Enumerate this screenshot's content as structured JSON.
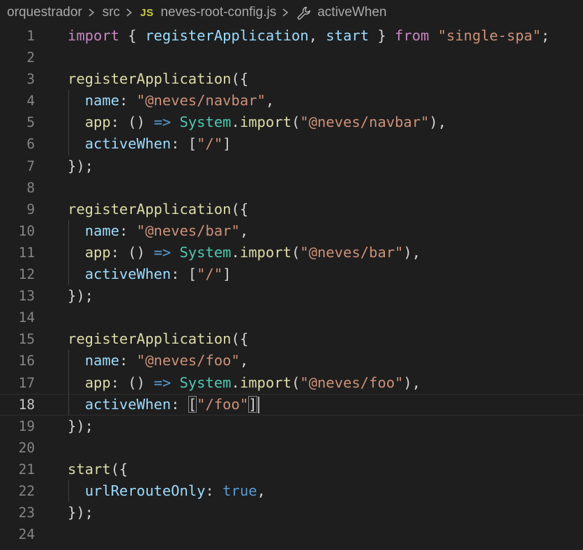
{
  "breadcrumb": {
    "folder": "orquestrador",
    "subfolder": "src",
    "file_badge": "JS",
    "file_name": "neves-root-config.js",
    "symbol": "activeWhen"
  },
  "colors": {
    "background": "#1e1e1e",
    "keyword": "#c586c0",
    "function": "#dcdcaa",
    "property": "#9cdcfe",
    "string": "#ce9178",
    "class": "#4ec9b0",
    "operator": "#569cd6",
    "line_number": "#858585",
    "js_badge": "#cbcb41"
  },
  "editor": {
    "current_line": 18,
    "lines": [
      {
        "n": "1",
        "tokens": [
          [
            "kw",
            "import"
          ],
          [
            "pn",
            " { "
          ],
          [
            "var",
            "registerApplication"
          ],
          [
            "pn",
            ", "
          ],
          [
            "var",
            "start"
          ],
          [
            "pn",
            " } "
          ],
          [
            "kw",
            "from"
          ],
          [
            "pn",
            " "
          ],
          [
            "str",
            "\"single-spa\""
          ],
          [
            "pn",
            ";"
          ]
        ]
      },
      {
        "n": "2",
        "tokens": []
      },
      {
        "n": "3",
        "tokens": [
          [
            "fn",
            "registerApplication"
          ],
          [
            "pn",
            "({"
          ]
        ]
      },
      {
        "n": "4",
        "tokens": [
          [
            "pn",
            "  "
          ],
          [
            "prop",
            "name"
          ],
          [
            "pn",
            ": "
          ],
          [
            "str",
            "\"@neves/navbar\""
          ],
          [
            "pn",
            ","
          ]
        ],
        "guide": true
      },
      {
        "n": "5",
        "tokens": [
          [
            "pn",
            "  "
          ],
          [
            "fn",
            "app"
          ],
          [
            "pn",
            ": () "
          ],
          [
            "op",
            "=>"
          ],
          [
            "pn",
            " "
          ],
          [
            "cls",
            "System"
          ],
          [
            "pn",
            "."
          ],
          [
            "fn",
            "import"
          ],
          [
            "pn",
            "("
          ],
          [
            "str",
            "\"@neves/navbar\""
          ],
          [
            "pn",
            "),"
          ]
        ],
        "guide": true
      },
      {
        "n": "6",
        "tokens": [
          [
            "pn",
            "  "
          ],
          [
            "prop",
            "activeWhen"
          ],
          [
            "pn",
            ": ["
          ],
          [
            "str",
            "\"/\""
          ],
          [
            "pn",
            "]"
          ]
        ],
        "guide": true
      },
      {
        "n": "7",
        "tokens": [
          [
            "pn",
            "});"
          ]
        ]
      },
      {
        "n": "8",
        "tokens": []
      },
      {
        "n": "9",
        "tokens": [
          [
            "fn",
            "registerApplication"
          ],
          [
            "pn",
            "({"
          ]
        ]
      },
      {
        "n": "10",
        "tokens": [
          [
            "pn",
            "  "
          ],
          [
            "prop",
            "name"
          ],
          [
            "pn",
            ": "
          ],
          [
            "str",
            "\"@neves/bar\""
          ],
          [
            "pn",
            ","
          ]
        ],
        "guide": true
      },
      {
        "n": "11",
        "tokens": [
          [
            "pn",
            "  "
          ],
          [
            "fn",
            "app"
          ],
          [
            "pn",
            ": () "
          ],
          [
            "op",
            "=>"
          ],
          [
            "pn",
            " "
          ],
          [
            "cls",
            "System"
          ],
          [
            "pn",
            "."
          ],
          [
            "fn",
            "import"
          ],
          [
            "pn",
            "("
          ],
          [
            "str",
            "\"@neves/bar\""
          ],
          [
            "pn",
            "),"
          ]
        ],
        "guide": true
      },
      {
        "n": "12",
        "tokens": [
          [
            "pn",
            "  "
          ],
          [
            "prop",
            "activeWhen"
          ],
          [
            "pn",
            ": ["
          ],
          [
            "str",
            "\"/\""
          ],
          [
            "pn",
            "]"
          ]
        ],
        "guide": true
      },
      {
        "n": "13",
        "tokens": [
          [
            "pn",
            "});"
          ]
        ]
      },
      {
        "n": "14",
        "tokens": []
      },
      {
        "n": "15",
        "tokens": [
          [
            "fn",
            "registerApplication"
          ],
          [
            "pn",
            "({"
          ]
        ]
      },
      {
        "n": "16",
        "tokens": [
          [
            "pn",
            "  "
          ],
          [
            "prop",
            "name"
          ],
          [
            "pn",
            ": "
          ],
          [
            "str",
            "\"@neves/foo\""
          ],
          [
            "pn",
            ","
          ]
        ],
        "guide": true
      },
      {
        "n": "17",
        "tokens": [
          [
            "pn",
            "  "
          ],
          [
            "fn",
            "app"
          ],
          [
            "pn",
            ": () "
          ],
          [
            "op",
            "=>"
          ],
          [
            "pn",
            " "
          ],
          [
            "cls",
            "System"
          ],
          [
            "pn",
            "."
          ],
          [
            "fn",
            "import"
          ],
          [
            "pn",
            "("
          ],
          [
            "str",
            "\"@neves/foo\""
          ],
          [
            "pn",
            "),"
          ]
        ],
        "guide": true
      },
      {
        "n": "18",
        "tokens": [
          [
            "pn",
            "  "
          ],
          [
            "prop",
            "activeWhen"
          ],
          [
            "pn",
            ": "
          ],
          [
            "bm",
            "["
          ],
          [
            "str",
            "\"/foo\""
          ],
          [
            "bm",
            "]"
          ],
          [
            "cursor",
            ""
          ]
        ],
        "guide": true
      },
      {
        "n": "19",
        "tokens": [
          [
            "pn",
            "});"
          ]
        ]
      },
      {
        "n": "20",
        "tokens": []
      },
      {
        "n": "21",
        "tokens": [
          [
            "fn",
            "start"
          ],
          [
            "pn",
            "({"
          ]
        ]
      },
      {
        "n": "22",
        "tokens": [
          [
            "pn",
            "  "
          ],
          [
            "prop",
            "urlRerouteOnly"
          ],
          [
            "pn",
            ": "
          ],
          [
            "bool",
            "true"
          ],
          [
            "pn",
            ","
          ]
        ],
        "guide": true
      },
      {
        "n": "23",
        "tokens": [
          [
            "pn",
            "});"
          ]
        ]
      },
      {
        "n": "24",
        "tokens": []
      }
    ]
  }
}
